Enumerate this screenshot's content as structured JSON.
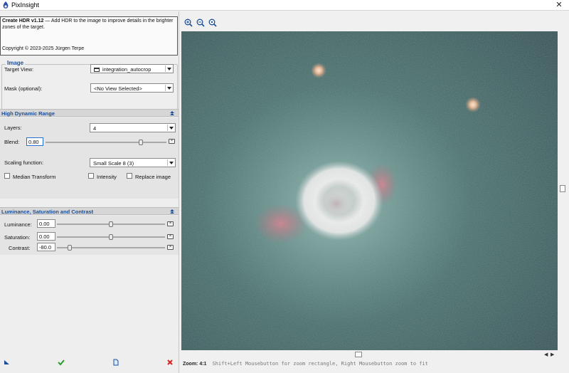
{
  "window": {
    "title": "PixInsight",
    "close_glyph": "✕"
  },
  "info": {
    "name": "Create HDR v1.12",
    "description": " — Add HDR to the image to improve details in the brighter zones of the target.",
    "copyright": "Copyright © 2023-2025 Jürgen Terpe"
  },
  "image_group": {
    "title": "Image",
    "target_view_label": "Target View:",
    "target_view_value": "integration_autocrop",
    "mask_label": "Mask (optional):",
    "mask_value": "<No View Selected>"
  },
  "hdr_section": {
    "title": "High Dynamic Range",
    "layers_label": "Layers:",
    "layers_value": "4",
    "blend_label": "Blend:",
    "blend_value": "0.80",
    "blend_fraction": 0.8,
    "scaling_label": "Scaling function:",
    "scaling_value": "Small Scale 8 (3)",
    "median_label": "Median Transform",
    "median_checked": false,
    "intensity_label": "Intensity",
    "intensity_checked": false,
    "replace_label": "Replace image",
    "replace_checked": false
  },
  "lsc_section": {
    "title": "Luminance, Saturation and Contrast",
    "luminance_label": "Luminance:",
    "luminance_value": "0.00",
    "saturation_label": "Saturation:",
    "saturation_value": "0.00",
    "contrast_label": "Contrast:",
    "contrast_value": "-80.0"
  },
  "bottom_buttons": {
    "new_instance_icon": "triangle-icon",
    "execute_icon": "check-icon",
    "reset_icon": "document-icon",
    "cancel_icon": "x-icon"
  },
  "toolbar": {
    "zoom_in_icon": "zoom-in-icon",
    "zoom_out_icon": "zoom-out-icon",
    "zoom_fit_icon": "zoom-fit-icon"
  },
  "status": {
    "zoom_label": "Zoom: 4:1",
    "hint": "Shift+Left Mousebutton for zoom rectangle, Right Mousebutton zoom to fit"
  },
  "colors": {
    "section_title": "#1a4e9a",
    "execute_green": "#2a9d2a",
    "cancel_red": "#d62020",
    "nebula_background": "#3e6866"
  }
}
